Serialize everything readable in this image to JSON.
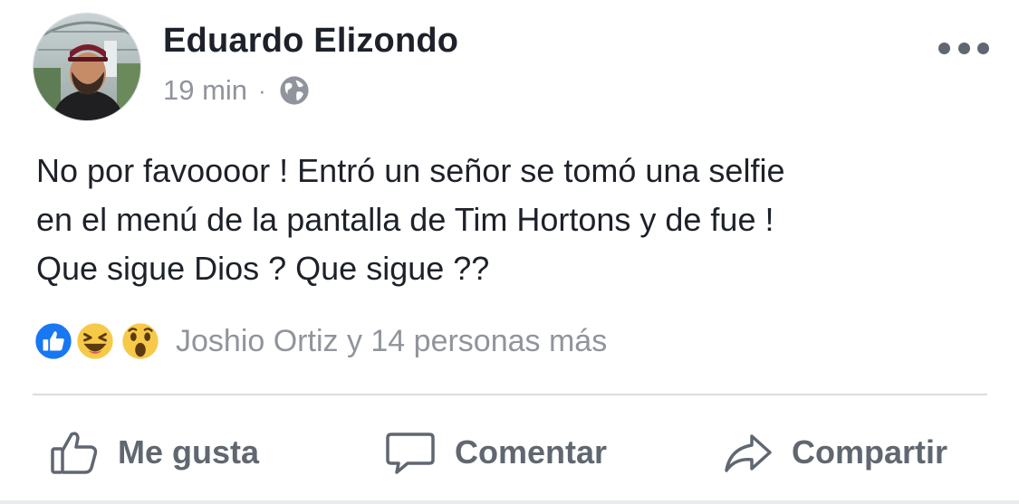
{
  "post": {
    "author": "Eduardo Elizondo",
    "time": "19 min",
    "separator": "·",
    "privacy_icon": "globe-icon",
    "more_icon": "more-options-icon",
    "text": "No por favoooor ! Entró un señor se tomó una selfie\nen el menú de la pantalla de Tim Hortons y de fue !\nQue sigue Dios ? Que sigue ??",
    "reactions": {
      "icons": [
        "like-icon",
        "haha-icon",
        "wow-icon"
      ],
      "summary": "Joshio Ortiz y 14 personas más"
    },
    "actions": {
      "like_label": "Me gusta",
      "comment_label": "Comentar",
      "share_label": "Compartir"
    }
  },
  "colors": {
    "text": "#1d2129",
    "secondary": "#90949c",
    "action": "#606770",
    "like_blue": "#1877f2",
    "emoji_yellow": "#f7c948"
  }
}
